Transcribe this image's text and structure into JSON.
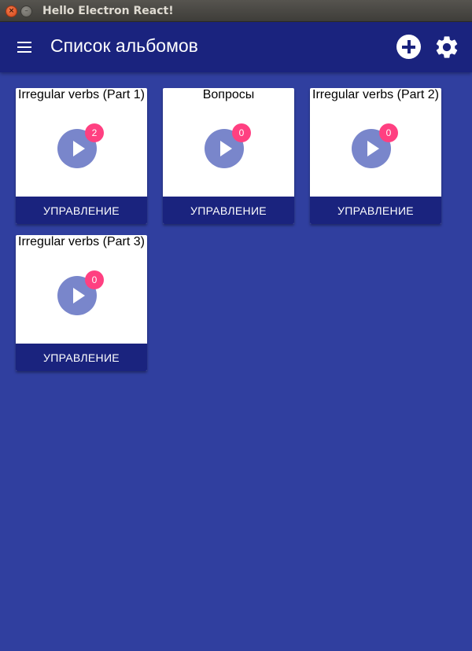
{
  "window": {
    "title": "Hello Electron React!",
    "close_glyph": "×",
    "minimize_glyph": "–"
  },
  "appbar": {
    "title": "Список альбомов",
    "menu_icon": "menu-icon",
    "add_icon": "add-circle-icon",
    "settings_icon": "gear-icon"
  },
  "colors": {
    "background": "#303f9f",
    "primary_dark": "#1a237e",
    "play_button": "#7986cb",
    "badge": "#ff4081"
  },
  "albums": [
    {
      "title": "Irregular verbs (Part 1)",
      "count": "2",
      "action_label": "УПРАВЛЕНИЕ"
    },
    {
      "title": "Вопросы",
      "count": "0",
      "action_label": "УПРАВЛЕНИЕ"
    },
    {
      "title": "Irregular verbs (Part 2)",
      "count": "0",
      "action_label": "УПРАВЛЕНИЕ"
    },
    {
      "title": "Irregular verbs (Part 3)",
      "count": "0",
      "action_label": "УПРАВЛЕНИЕ"
    }
  ]
}
